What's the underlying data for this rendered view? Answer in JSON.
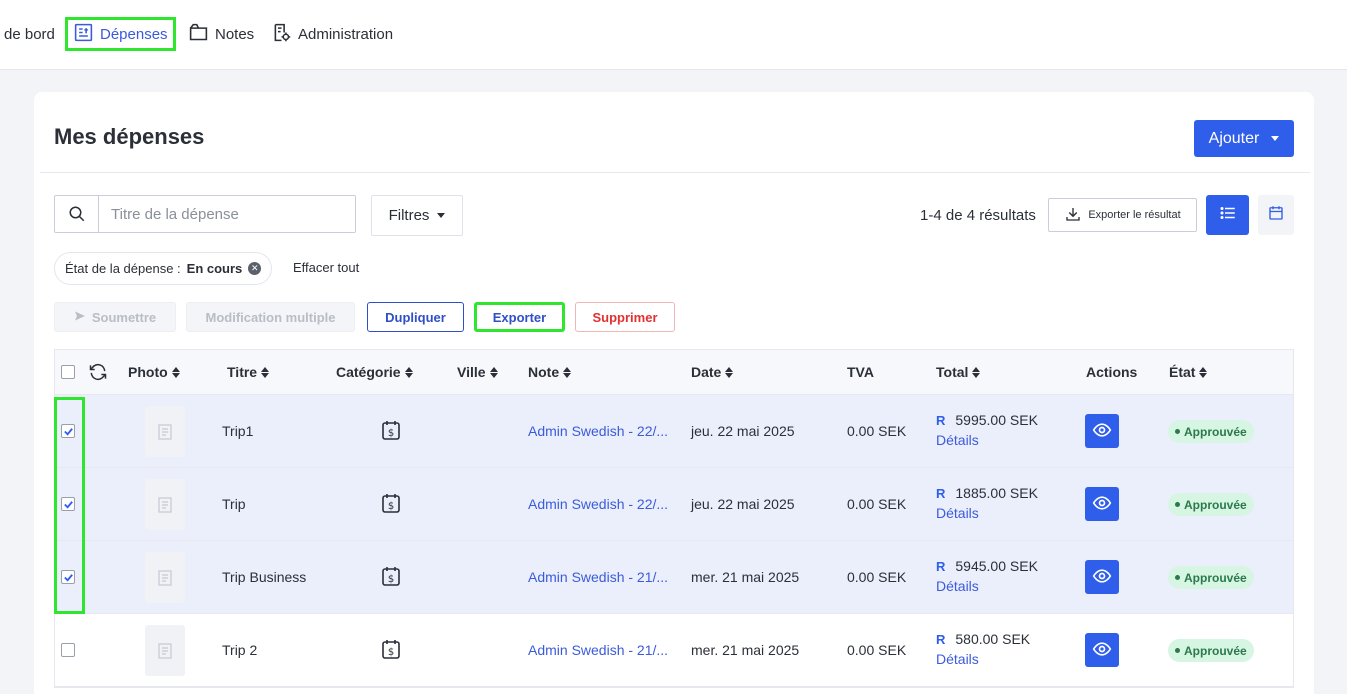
{
  "nav": {
    "items": [
      {
        "label": "de bord"
      },
      {
        "label": "Dépenses"
      },
      {
        "label": "Notes"
      },
      {
        "label": "Administration"
      }
    ]
  },
  "page": {
    "title": "Mes dépenses",
    "add_label": "Ajouter"
  },
  "toolbar": {
    "search_placeholder": "Titre de la dépense",
    "filters_label": "Filtres",
    "results_text": "1-4 de 4 résultats",
    "export_result_label": "Exporter le résultat"
  },
  "filter_chip": {
    "label": "État de la dépense :",
    "value": "En cours",
    "clear_all": "Effacer tout"
  },
  "actions": {
    "submit": "Soumettre",
    "bulk_edit": "Modification multiple",
    "duplicate": "Dupliquer",
    "export": "Exporter",
    "delete": "Supprimer"
  },
  "table": {
    "headers": {
      "photo": "Photo",
      "title": "Titre",
      "category": "Catégorie",
      "city": "Ville",
      "note": "Note",
      "date": "Date",
      "vat": "TVA",
      "total": "Total",
      "actions": "Actions",
      "status": "État"
    },
    "rows": [
      {
        "title": "Trip1",
        "note": "Admin Swedish - 22/...",
        "date": "jeu. 22 mai 2025",
        "vat": "0.00 SEK",
        "total_prefix": "R",
        "total": "5995.00 SEK",
        "details": "Détails",
        "status": "Approuvée"
      },
      {
        "title": "Trip",
        "note": "Admin Swedish - 22/...",
        "date": "jeu. 22 mai 2025",
        "vat": "0.00 SEK",
        "total_prefix": "R",
        "total": "1885.00 SEK",
        "details": "Détails",
        "status": "Approuvée"
      },
      {
        "title": "Trip Business",
        "note": "Admin Swedish - 21/...",
        "date": "mer. 21 mai 2025",
        "vat": "0.00 SEK",
        "total_prefix": "R",
        "total": "5945.00 SEK",
        "details": "Détails",
        "status": "Approuvée"
      },
      {
        "title": "Trip 2",
        "note": "Admin Swedish - 21/...",
        "date": "mer. 21 mai 2025",
        "vat": "0.00 SEK",
        "total_prefix": "R",
        "total": "580.00 SEK",
        "details": "Détails",
        "status": "Approuvée"
      }
    ]
  },
  "colors": {
    "primary": "#2f5eea",
    "highlight": "#2ee62e",
    "status_bg": "#d7f5e3",
    "status_text": "#2b7a4b",
    "danger": "#e03131"
  }
}
